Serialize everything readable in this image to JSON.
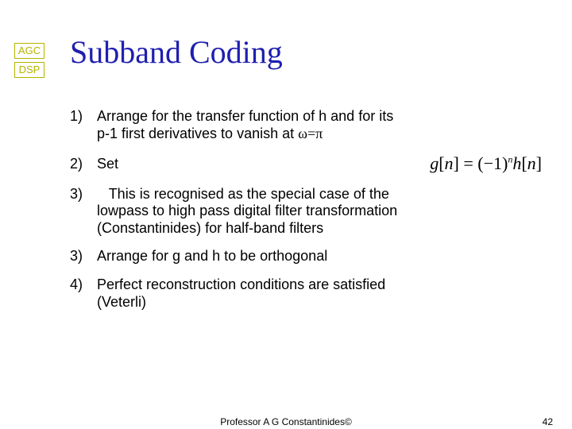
{
  "logo": {
    "top": "AGC",
    "bottom": "DSP"
  },
  "title": "Subband Coding",
  "items": {
    "i1": {
      "num": "1)",
      "text_a": "Arrange for the transfer function of h and for its",
      "text_b": "p-1 first derivatives to vanish at ",
      "omega_eq_pi": "ω=π"
    },
    "i2": {
      "num": "2)",
      "text": "Set"
    },
    "i3": {
      "num": "3)",
      "lead_space": "   ",
      "text_a": "This is recognised as the special case of the",
      "text_b": "lowpass to high pass digital filter transformation",
      "text_c": "(Constantinides) for half-band filters"
    },
    "i3b": {
      "num": "3)",
      "text": "Arrange for g and h to be orthogonal"
    },
    "i4": {
      "num": "4)",
      "text_a": "Perfect reconstruction conditions are satisfied",
      "text_b": "(Veterli)"
    }
  },
  "formula": {
    "g": "g",
    "lbr": "[",
    "n": "n",
    "rbr": "]",
    "eq": " = ",
    "lp": "(",
    "minus1": "−1",
    "rp": ")",
    "exp": "n",
    "h": "h"
  },
  "footer": {
    "center": "Professor A G Constantinides©",
    "page": "42"
  }
}
